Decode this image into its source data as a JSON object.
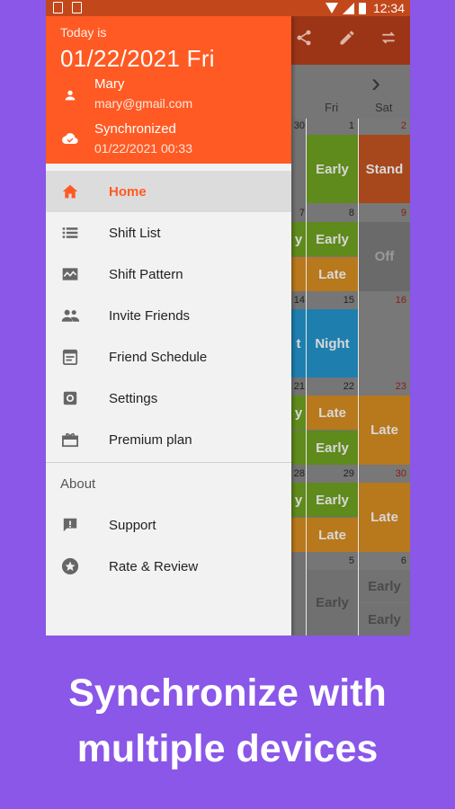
{
  "status_bar": {
    "time": "12:34"
  },
  "drawer": {
    "header": {
      "today_label": "Today is",
      "date": "01/22/2021 Fri",
      "user_name": "Mary",
      "user_email": "mary@gmail.com",
      "sync_status": "Synchronized",
      "sync_time": "01/22/2021 00:33"
    },
    "menu": [
      {
        "label": "Home",
        "icon": "home-icon",
        "active": true
      },
      {
        "label": "Shift List",
        "icon": "list-icon"
      },
      {
        "label": "Shift Pattern",
        "icon": "pattern-icon"
      },
      {
        "label": "Invite Friends",
        "icon": "people-icon"
      },
      {
        "label": "Friend Schedule",
        "icon": "calendar-icon"
      },
      {
        "label": "Settings",
        "icon": "gear-icon"
      },
      {
        "label": "Premium plan",
        "icon": "gift-icon"
      }
    ],
    "about": {
      "section_label": "About",
      "items": [
        {
          "label": "Support",
          "icon": "feedback-icon"
        },
        {
          "label": "Rate & Review",
          "icon": "star-icon"
        }
      ]
    }
  },
  "calendar": {
    "day_names": [
      "Fri",
      "Sat"
    ],
    "days": [
      "30",
      "1",
      "2",
      "7",
      "8",
      "9",
      "14",
      "15",
      "16",
      "21",
      "22",
      "23",
      "28",
      "29",
      "30",
      "5",
      "6"
    ],
    "shifts": {
      "early": "Early",
      "stand": "Stand",
      "late": "Late",
      "off": "Off",
      "night": "Night",
      "t": "t",
      "y": "y"
    },
    "colors": {
      "early": "#5f8a1c",
      "stand": "#a6481c",
      "late": "#b8781c",
      "off": "#4a4a4a",
      "night": "#1e7fae"
    }
  },
  "caption": {
    "line1": "Synchronize with",
    "line2": "multiple devices"
  },
  "colors": {
    "background": "#8a57e8",
    "accent": "#ff5a23",
    "status_bar": "#c2481b",
    "toolbar_dim": "#9b3516"
  }
}
